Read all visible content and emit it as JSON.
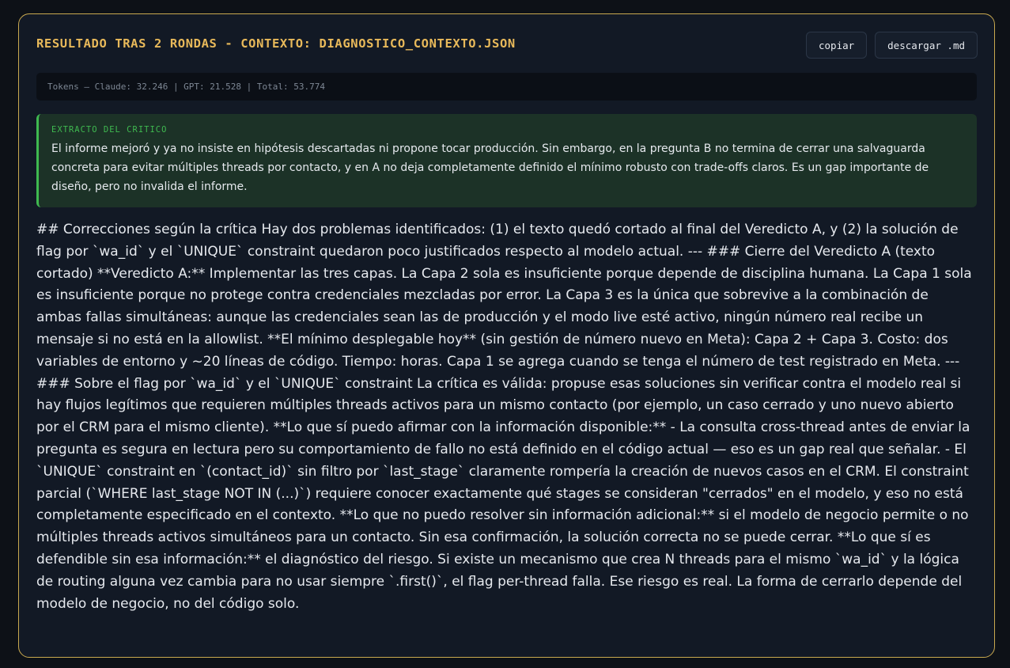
{
  "header": {
    "title": "RESULTADO TRAS 2 RONDAS - CONTEXTO: DIAGNOSTICO_CONTEXTO.JSON",
    "copy_label": "copiar",
    "download_label": "descargar .md"
  },
  "tokens": {
    "text": "Tokens — Claude: 32.246 | GPT: 21.528 | Total: 53.774"
  },
  "critic": {
    "label": "EXTRACTO DEL CRITICO",
    "text": "El informe mejoró y ya no insiste en hipótesis descartadas ni propone tocar producción. Sin embargo, en la pregunta B no termina de cerrar una salvaguarda concreta para evitar múltiples threads por contacto, y en A no deja completamente definido el mínimo robusto con trade-offs claros. Es un gap importante de diseño, pero no invalida el informe."
  },
  "result": {
    "text": "## Correcciones según la crítica Hay dos problemas identificados: (1) el texto quedó cortado al final del Veredicto A, y (2) la solución de flag por `wa_id` y el `UNIQUE` constraint quedaron poco justificados respecto al modelo actual. --- ### Cierre del Veredicto A (texto cortado) **Veredicto A:** Implementar las tres capas. La Capa 2 sola es insuficiente porque depende de disciplina humana. La Capa 1 sola es insuficiente porque no protege contra credenciales mezcladas por error. La Capa 3 es la única que sobrevive a la combinación de ambas fallas simultáneas: aunque las credenciales sean las de producción y el modo live esté activo, ningún número real recibe un mensaje si no está en la allowlist. **El mínimo desplegable hoy** (sin gestión de número nuevo en Meta): Capa 2 + Capa 3. Costo: dos variables de entorno y ~20 líneas de código. Tiempo: horas. Capa 1 se agrega cuando se tenga el número de test registrado en Meta. --- ### Sobre el flag por `wa_id` y el `UNIQUE` constraint La crítica es válida: propuse esas soluciones sin verificar contra el modelo real si hay flujos legítimos que requieren múltiples threads activos para un mismo contacto (por ejemplo, un caso cerrado y uno nuevo abierto por el CRM para el mismo cliente). **Lo que sí puedo afirmar con la información disponible:** - La consulta cross-thread antes de enviar la pregunta es segura en lectura pero su comportamiento de fallo no está definido en el código actual — eso es un gap real que señalar. - El `UNIQUE` constraint en `(contact_id)` sin filtro por `last_stage` claramente rompería la creación de nuevos casos en el CRM. El constraint parcial (`WHERE last_stage NOT IN (...)`) requiere conocer exactamente qué stages se consideran \"cerrados\" en el modelo, y eso no está completamente especificado en el contexto. **Lo que no puedo resolver sin información adicional:** si el modelo de negocio permite o no múltiples threads activos simultáneos para un contacto. Sin esa confirmación, la solución correcta no se puede cerrar. **Lo que sí es defendible sin esa información:** el diagnóstico del riesgo. Si existe un mecanismo que crea N threads para el mismo `wa_id` y la lógica de routing alguna vez cambia para no usar siempre `.first()`, el flag per-thread falla. Ese riesgo es real. La forma de cerrarlo depende del modelo de negocio, no del código solo."
  },
  "colors": {
    "accent": "#e8b95a",
    "critic_accent": "#3fb950",
    "background": "#121925"
  }
}
